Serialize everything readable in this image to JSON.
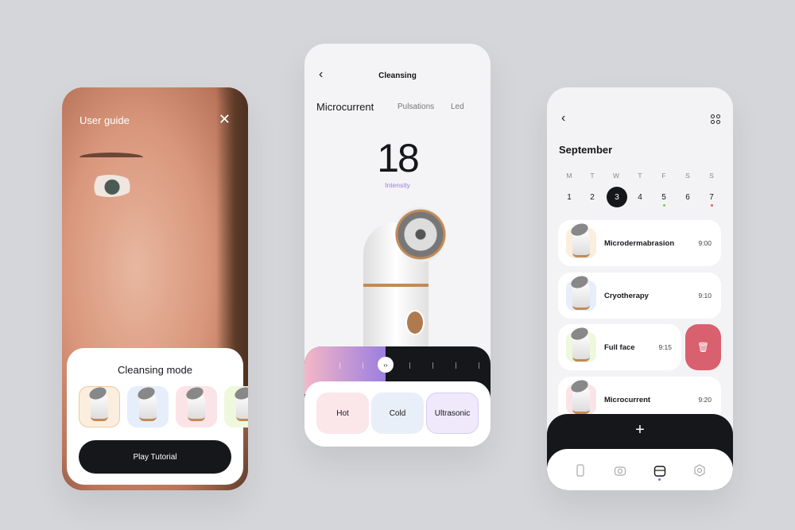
{
  "guide": {
    "title": "User guide",
    "card_title": "Cleansing mode",
    "thumbs": [
      "#fbeede",
      "#e6eefb",
      "#fbe4e8",
      "#eef8dc"
    ],
    "play_label": "Play Tutorial"
  },
  "device": {
    "title": "Cleansing",
    "tabs": [
      "Microcurrent",
      "Pulsations",
      "Led"
    ],
    "value": "18",
    "value_label": "Intensity",
    "slider_level_percent": 40,
    "options": [
      {
        "label": "Hot",
        "color": "#fbe6ea"
      },
      {
        "label": "Cold",
        "color": "#e8eff9"
      },
      {
        "label": "Ultrasonic",
        "color": "#efe9fb"
      }
    ]
  },
  "schedule": {
    "month": "September",
    "weekdays": [
      "M",
      "T",
      "W",
      "T",
      "F",
      "S",
      "S"
    ],
    "days": [
      "1",
      "2",
      "3",
      "4",
      "5",
      "6",
      "7"
    ],
    "selected_day": "3",
    "items": [
      {
        "name": "Microdermabrasion",
        "time": "9:00",
        "color": "#fbeede"
      },
      {
        "name": "Cryotherapy",
        "time": "9:10",
        "color": "#e6eefb"
      },
      {
        "name": "Full face",
        "time": "9:15",
        "color": "#eef8dc"
      },
      {
        "name": "Microcurrent",
        "time": "9:20",
        "color": "#fbe4e8"
      }
    ],
    "add_label": "+",
    "delete_color": "#d9606e",
    "nav": [
      "device-icon",
      "camera-icon",
      "calendar-icon",
      "settings-icon"
    ],
    "accent": "#8b5cf6"
  }
}
